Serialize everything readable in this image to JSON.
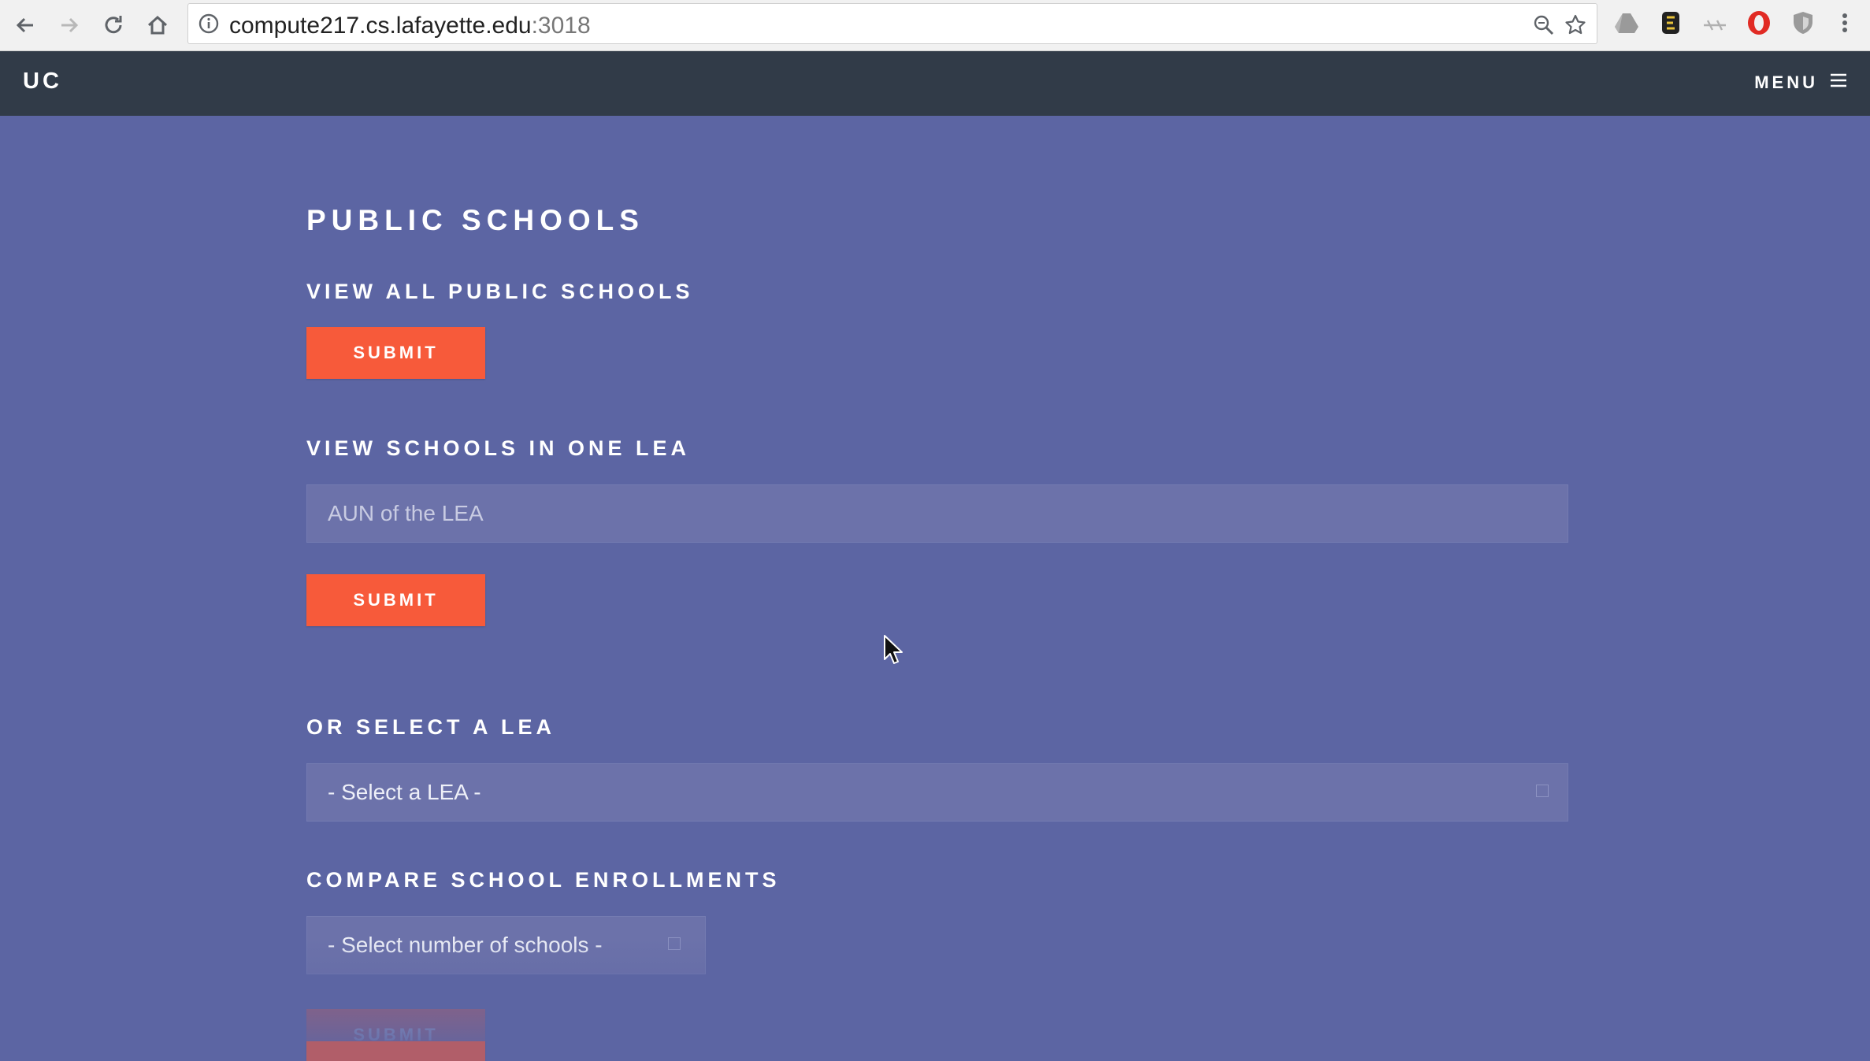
{
  "browser": {
    "url_host": "compute217.cs.lafayette.edu",
    "url_port": ":3018",
    "icons": [
      "back-icon",
      "forward-icon",
      "reload-icon",
      "home-icon",
      "info-icon",
      "zoom-icon",
      "star-icon",
      "drive-icon",
      "evernote-icon",
      "extension-icon",
      "opera-icon",
      "shield-icon",
      "kebab-menu-icon"
    ]
  },
  "site": {
    "logo": "UC",
    "menu_label": "MENU"
  },
  "page": {
    "title": "PUBLIC SCHOOLS",
    "view_all": {
      "heading": "VIEW ALL PUBLIC SCHOOLS",
      "submit_label": "SUBMIT"
    },
    "one_lea": {
      "heading": "VIEW SCHOOLS IN ONE LEA",
      "input_placeholder": "AUN of the LEA",
      "submit_label": "SUBMIT"
    },
    "select_lea": {
      "heading": "OR SELECT A LEA",
      "selected": "- Select a LEA -"
    },
    "compare": {
      "heading": "COMPARE SCHOOL ENROLLMENTS",
      "selected": "- Select number of schools -",
      "submit_label": "SUBMIT"
    }
  },
  "colors": {
    "background": "#5c65a3",
    "nav": "#313b48",
    "accent": "#f75a3a"
  }
}
